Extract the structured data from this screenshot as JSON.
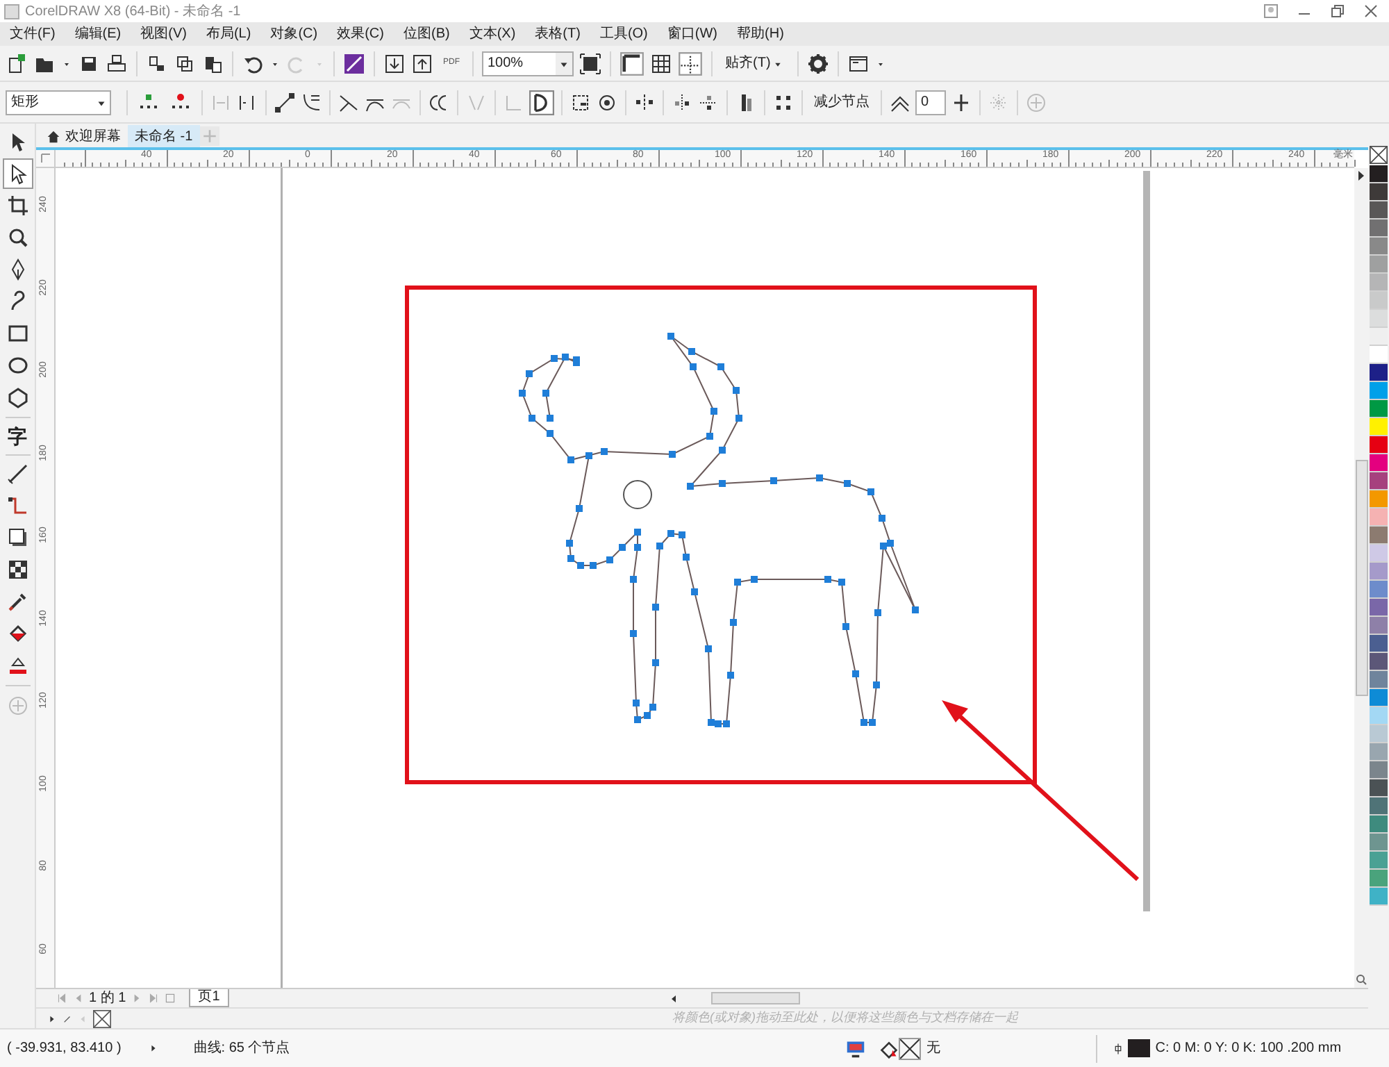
{
  "window": {
    "title": "CorelDRAW X8 (64-Bit) - 未命名 -1"
  },
  "menu": [
    "文件(F)",
    "编辑(E)",
    "视图(V)",
    "布局(L)",
    "对象(C)",
    "效果(C)",
    "位图(B)",
    "文本(X)",
    "表格(T)",
    "工具(O)",
    "窗口(W)",
    "帮助(H)"
  ],
  "standard_toolbar": {
    "pdf_label": "PDF",
    "zoom": "100%",
    "snap_label": "贴齐(T)"
  },
  "property_bar": {
    "shape_dropdown": "矩形",
    "reduce_nodes": "减少节点",
    "smoothing": "0"
  },
  "toolbox": {
    "text_tool": "字"
  },
  "tabs": [
    {
      "label": "欢迎屏幕",
      "selected": false,
      "kind": "home"
    },
    {
      "label": "未命名 -1",
      "selected": true,
      "kind": "document"
    }
  ],
  "horizontal_ruler": {
    "labels": [
      "40",
      "20",
      "0",
      "20",
      "40",
      "60",
      "80",
      "100",
      "120",
      "140",
      "160",
      "180",
      "200",
      "220",
      "240"
    ],
    "unit": "毫米"
  },
  "vertical_ruler": {
    "labels": [
      "240",
      "220",
      "200",
      "180",
      "160",
      "140",
      "120",
      "100",
      "80",
      "60"
    ]
  },
  "page_navigator": {
    "count": "1 的 1",
    "page_tab": "页1"
  },
  "document_palette": {
    "hint": "将颜色(或对象)拖动至此处，以便将这些颜色与文档存储在一起"
  },
  "palette": [
    {
      "kind": "none"
    },
    {
      "kind": "color",
      "color": "#231f20"
    },
    {
      "kind": "color",
      "color": "#3e3a39"
    },
    {
      "kind": "color",
      "color": "#595757"
    },
    {
      "kind": "color",
      "color": "#717071"
    },
    {
      "kind": "color",
      "color": "#898989"
    },
    {
      "kind": "color",
      "color": "#9fa0a0"
    },
    {
      "kind": "color",
      "color": "#b5b5b6"
    },
    {
      "kind": "color",
      "color": "#c9caca"
    },
    {
      "kind": "color",
      "color": "#dcdddd"
    },
    {
      "kind": "color",
      "color": "#efefef"
    },
    {
      "kind": "color",
      "color": "#ffffff"
    },
    {
      "kind": "color",
      "color": "#1d2088"
    },
    {
      "kind": "color",
      "color": "#00a0e9"
    },
    {
      "kind": "color",
      "color": "#009944"
    },
    {
      "kind": "color",
      "color": "#fff100"
    },
    {
      "kind": "color",
      "color": "#e60012"
    },
    {
      "kind": "color",
      "color": "#e4007f"
    },
    {
      "kind": "color",
      "color": "#a6417e"
    },
    {
      "kind": "color",
      "color": "#f39800"
    },
    {
      "kind": "color",
      "color": "#f5b2b2"
    },
    {
      "kind": "color",
      "color": "#8c7b70"
    },
    {
      "kind": "color",
      "color": "#cfc9e6"
    },
    {
      "kind": "color",
      "color": "#a59aca"
    },
    {
      "kind": "color",
      "color": "#6d8ccb"
    },
    {
      "kind": "color",
      "color": "#7a67a8"
    },
    {
      "kind": "color",
      "color": "#8e80a8"
    },
    {
      "kind": "color",
      "color": "#4b5f91"
    },
    {
      "kind": "color",
      "color": "#5c5778"
    },
    {
      "kind": "color",
      "color": "#6f849c"
    },
    {
      "kind": "color",
      "color": "#0e8bd6"
    },
    {
      "kind": "color",
      "color": "#a3d8f4"
    },
    {
      "kind": "color",
      "color": "#b9c9d4"
    },
    {
      "kind": "color",
      "color": "#99a6af"
    },
    {
      "kind": "color",
      "color": "#7b858c"
    },
    {
      "kind": "color",
      "color": "#4b5255"
    },
    {
      "kind": "color",
      "color": "#4f7377"
    },
    {
      "kind": "color",
      "color": "#3e8b7e"
    },
    {
      "kind": "color",
      "color": "#6e9590"
    },
    {
      "kind": "color",
      "color": "#4aa194"
    },
    {
      "kind": "color",
      "color": "#4aa37c"
    },
    {
      "kind": "color",
      "color": "#3fb2c6"
    }
  ],
  "status_bar": {
    "coordinates": "( -39.931, 83.410 )",
    "selection": "曲线: 65 个节点",
    "fill": "无",
    "outline": "C: 0 M: 0 Y: 0 K: 100 .200 mm"
  }
}
